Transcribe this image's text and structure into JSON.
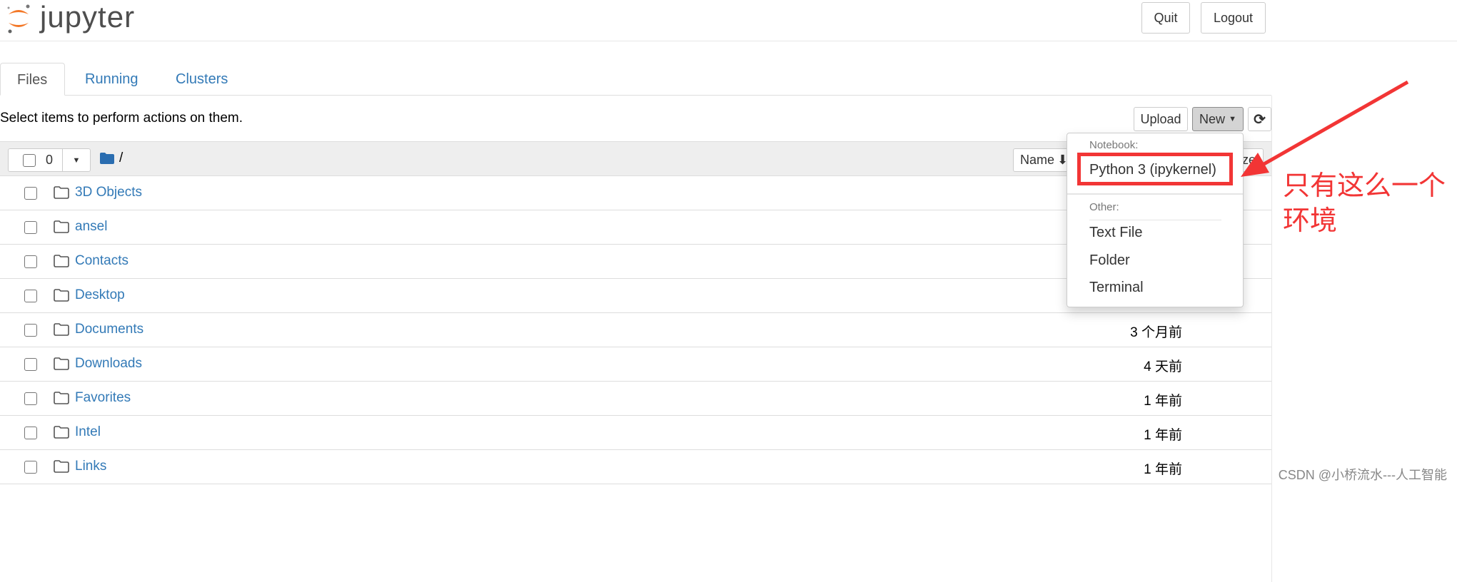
{
  "header": {
    "logo_text": "jupyter",
    "quit_label": "Quit",
    "logout_label": "Logout"
  },
  "tabs": [
    {
      "label": "Files",
      "active": true
    },
    {
      "label": "Running"
    },
    {
      "label": "Clusters"
    }
  ],
  "toolbar": {
    "hint": "Select items to perform actions on them.",
    "upload_label": "Upload",
    "new_label": "New",
    "refresh_icon": "refresh-icon"
  },
  "list_header": {
    "selected_count": "0",
    "path": "/",
    "name_col": "Name",
    "size_col_fragment": "ze"
  },
  "rows": [
    {
      "name": "3D Objects",
      "modified": ""
    },
    {
      "name": "ansel",
      "modified": ""
    },
    {
      "name": "Contacts",
      "modified": ""
    },
    {
      "name": "Desktop",
      "modified": ""
    },
    {
      "name": "Documents",
      "modified": "3 个月前"
    },
    {
      "name": "Downloads",
      "modified": "4 天前"
    },
    {
      "name": "Favorites",
      "modified": "1 年前"
    },
    {
      "name": "Intel",
      "modified": "1 年前"
    },
    {
      "name": "Links",
      "modified": "1 年前"
    }
  ],
  "new_menu": {
    "notebook_header": "Notebook:",
    "python_kernel": "Python 3 (ipykernel)",
    "other_header": "Other:",
    "text_file": "Text File",
    "folder": "Folder",
    "terminal": "Terminal"
  },
  "annotation": {
    "line1": "只有这么一个",
    "line2": "环境",
    "color": "#f23535"
  },
  "watermark": "CSDN @小桥流水---人工智能"
}
